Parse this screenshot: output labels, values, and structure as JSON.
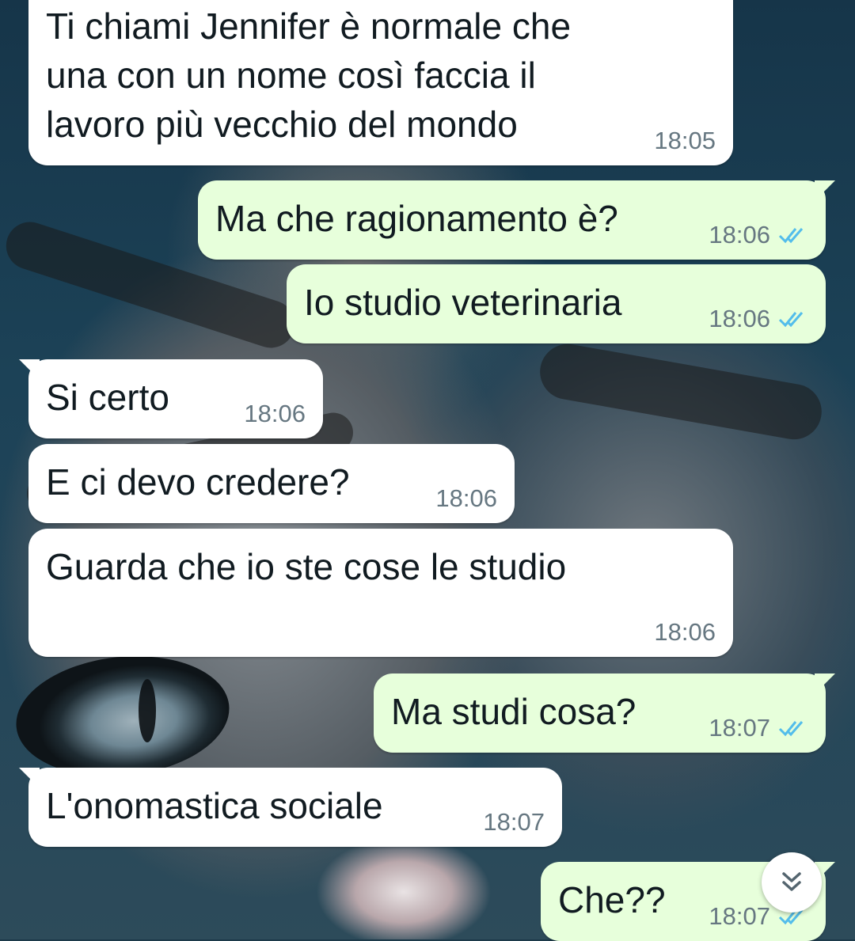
{
  "chat": {
    "messages": [
      {
        "direction": "in",
        "text": "Ti chiami Jennifer è normale che\nuna con un nome così faccia il\nlavoro più vecchio del mondo",
        "time": "18:05"
      },
      {
        "direction": "out",
        "text": "Ma che ragionamento è?",
        "time": "18:06",
        "status": "read"
      },
      {
        "direction": "out",
        "text": "Io studio veterinaria",
        "time": "18:06",
        "status": "read"
      },
      {
        "direction": "in",
        "text": "Si certo",
        "time": "18:06"
      },
      {
        "direction": "in",
        "text": "E ci devo credere?",
        "time": "18:06"
      },
      {
        "direction": "in",
        "text": "Guarda che io ste cose le studio",
        "time": "18:06"
      },
      {
        "direction": "out",
        "text": "Ma studi cosa?",
        "time": "18:07",
        "status": "read"
      },
      {
        "direction": "in",
        "text": "L'onomastica sociale",
        "time": "18:07"
      },
      {
        "direction": "out",
        "text": "Che??",
        "time": "18:07",
        "status": "read"
      }
    ]
  },
  "colors": {
    "incoming_bubble": "#ffffff",
    "outgoing_bubble": "#e7ffdb",
    "read_ticks": "#53bdeb",
    "timestamp": "#667781"
  },
  "icons": {
    "read_receipt": "double-check-icon",
    "scroll_down": "double-chevron-down-icon"
  }
}
